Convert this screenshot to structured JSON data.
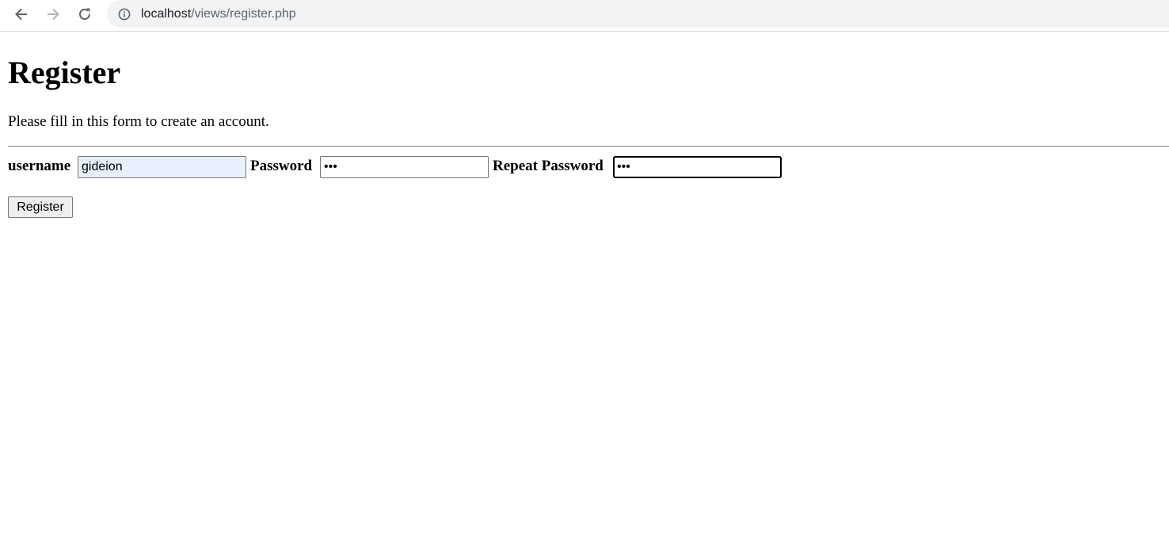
{
  "browser": {
    "url_host": "localhost",
    "url_path": "/views/register.php",
    "icons": {
      "back": "back-arrow-icon",
      "forward": "forward-arrow-icon",
      "reload": "reload-icon",
      "site_info": "info-icon"
    }
  },
  "page": {
    "title": "Register",
    "intro": "Please fill in this form to create an account."
  },
  "form": {
    "username": {
      "label": "username",
      "value": "gideion"
    },
    "password": {
      "label": "Password",
      "value": "•••"
    },
    "repeat_password": {
      "label": "Repeat Password",
      "value": "•••"
    },
    "submit_label": "Register"
  },
  "colors": {
    "autofill_background": "#e8f0fe",
    "omnibox_background": "#f1f3f4"
  }
}
